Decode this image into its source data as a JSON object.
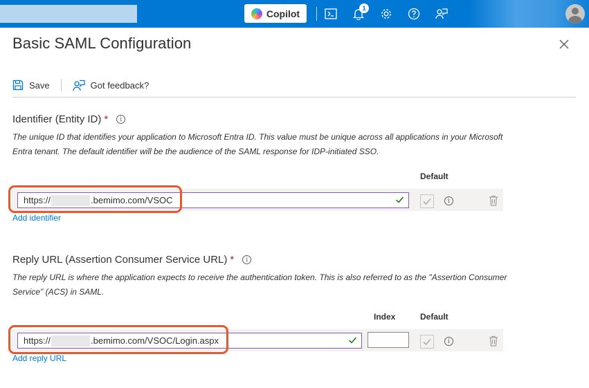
{
  "topbar": {
    "copilot_label": "Copilot",
    "notification_count": "1",
    "icons": [
      "cloud-shell-icon",
      "bell-icon",
      "gear-icon",
      "help-icon",
      "feedback-icon"
    ]
  },
  "blade": {
    "title": "Basic SAML Configuration"
  },
  "commands": {
    "save_label": "Save",
    "feedback_label": "Got feedback?"
  },
  "identifier": {
    "title": "Identifier (Entity ID)",
    "required_mark": "*",
    "description": "The unique ID that identifies your application to Microsoft Entra ID. This value must be unique across all applications in your Microsoft Entra tenant. The default identifier will be the audience of the SAML response for IDP-initiated SSO.",
    "default_header": "Default",
    "value_prefix": "https://",
    "value_suffix": ".bemimo.com/VSOC",
    "add_link": "Add identifier"
  },
  "reply_url": {
    "title": "Reply URL (Assertion Consumer Service URL)",
    "required_mark": "*",
    "description": "The reply URL is where the application expects to receive the authentication token. This is also referred to as the \"Assertion Consumer Service\" (ACS) in SAML.",
    "index_header": "Index",
    "default_header": "Default",
    "value_prefix": "https://",
    "value_suffix": ".bemimo.com/VSOC/Login.aspx",
    "index_value": "",
    "add_link": "Add reply URL"
  },
  "colors": {
    "azure_blue": "#0078d4",
    "highlight_orange": "#e8582a",
    "valid_green": "#107c10",
    "required_red": "#a4262c"
  }
}
